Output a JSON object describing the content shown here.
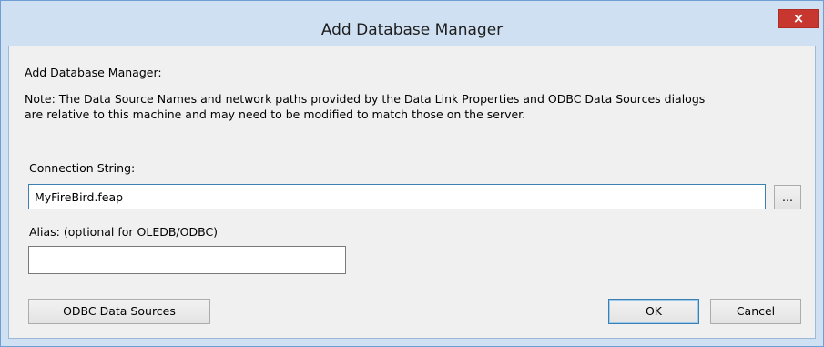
{
  "window": {
    "title": "Add Database Manager",
    "close_glyph": "×"
  },
  "dialog": {
    "heading": "Add Database Manager:",
    "note_line1": "Note: The Data Source Names and network paths provided by the Data Link Properties and ODBC Data Sources dialogs",
    "note_line2": "are relative to this machine and may need to be modified to match those on the server.",
    "connection_label": "Connection String:",
    "connection_value": "MyFireBird.feap",
    "browse_label": "...",
    "alias_label": "Alias: (optional for OLEDB/ODBC)",
    "alias_value": ""
  },
  "buttons": {
    "odbc": "ODBC Data Sources",
    "ok": "OK",
    "cancel": "Cancel"
  },
  "colors": {
    "titlebar": "#cfe0f2",
    "close": "#c7362f",
    "client": "#f0f0f0",
    "focus_border": "#3c7fb1"
  }
}
